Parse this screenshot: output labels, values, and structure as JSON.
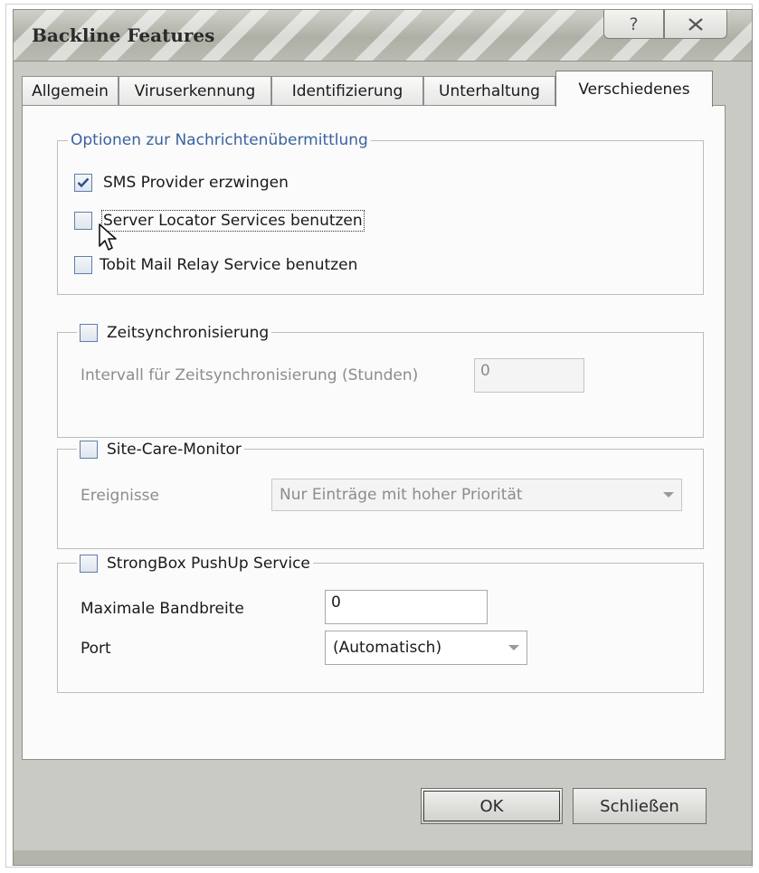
{
  "window": {
    "title": "Backline Features",
    "help_label": "?"
  },
  "tabs": [
    {
      "label": "Allgemein",
      "active": false
    },
    {
      "label": "Viruserkennung",
      "active": false
    },
    {
      "label": "Identifizierung",
      "active": false
    },
    {
      "label": "Unterhaltung",
      "active": false
    },
    {
      "label": "Verschiedenes",
      "active": true
    }
  ],
  "messaging": {
    "title": "Optionen zur Nachrichtenübermittlung",
    "options": [
      {
        "label": "SMS Provider erzwingen",
        "checked": true
      },
      {
        "label": "Server Locator Services benutzen",
        "checked": false
      },
      {
        "label": "Tobit Mail Relay Service benutzen",
        "checked": false
      }
    ]
  },
  "timesync": {
    "title": "Zeitsynchronisierung",
    "checked": false,
    "interval_label": "Intervall für Zeitsynchronisierung (Stunden)",
    "interval_value": "0"
  },
  "sitecare": {
    "title": "Site-Care-Monitor",
    "checked": false,
    "events_label": "Ereignisse",
    "events_value": "Nur Einträge mit hoher Priorität"
  },
  "strongbox": {
    "title": "StrongBox PushUp Service",
    "checked": false,
    "bandwidth_label": "Maximale Bandbreite",
    "bandwidth_value": "0",
    "port_label": "Port",
    "port_value": "(Automatisch)"
  },
  "buttons": {
    "ok": "OK",
    "close": "Schließen"
  },
  "colors": {
    "accent": "#3a62a0",
    "window_bg": "#c9cac3"
  }
}
